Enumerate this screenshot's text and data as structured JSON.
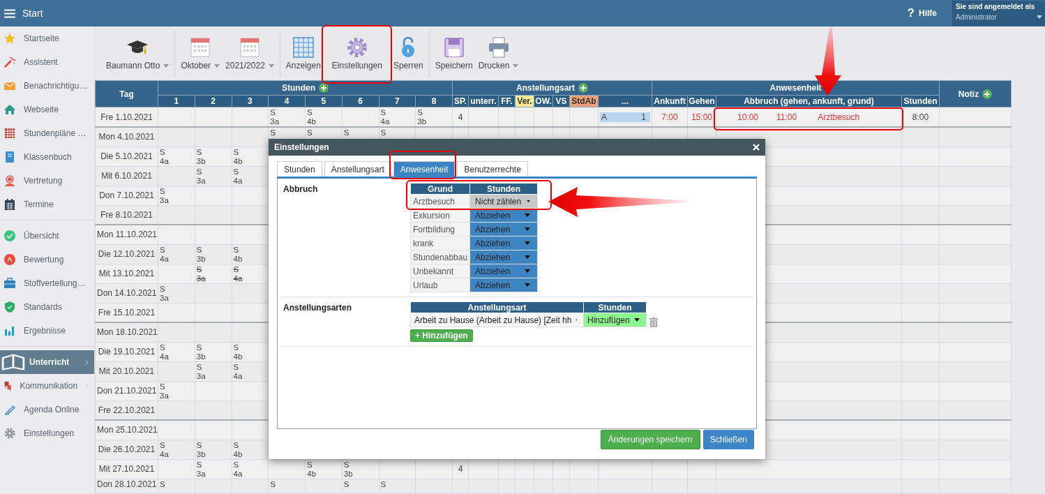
{
  "topbar": {
    "title": "Start",
    "help_symbol": "?",
    "help": "Hilfe",
    "login_label": "Sie sind angemeldet als",
    "login_user": "Administrator"
  },
  "sidebar": {
    "sections": [
      {
        "items": [
          {
            "label": "Startseite",
            "selected": false,
            "submenu": false
          },
          {
            "label": "Assistent",
            "selected": false,
            "submenu": false
          },
          {
            "label": "Benachrichtigu…",
            "selected": false,
            "submenu": false
          },
          {
            "label": "Webseite",
            "selected": false,
            "submenu": false
          },
          {
            "label": "Stundenpläne …",
            "selected": false,
            "submenu": false
          },
          {
            "label": "Klassenbuch",
            "selected": false,
            "submenu": false
          },
          {
            "label": "Vertretung",
            "selected": false,
            "submenu": false
          },
          {
            "label": "Termine",
            "selected": false,
            "submenu": false
          }
        ]
      },
      {
        "items": [
          {
            "label": "Übersicht",
            "selected": false,
            "submenu": false
          },
          {
            "label": "Bewertung",
            "selected": false,
            "submenu": false
          },
          {
            "label": "Stoffverteilung…",
            "selected": false,
            "submenu": false
          },
          {
            "label": "Standards",
            "selected": false,
            "submenu": false
          },
          {
            "label": "Ergebnisse",
            "selected": false,
            "submenu": false
          }
        ]
      },
      {
        "items": [
          {
            "label": "Unterricht",
            "selected": true,
            "submenu": true
          },
          {
            "label": "Kommunikation",
            "selected": false,
            "submenu": true
          },
          {
            "label": "Agenda Online",
            "selected": false,
            "submenu": false
          },
          {
            "label": "Einstellungen",
            "selected": false,
            "submenu": false
          }
        ]
      }
    ]
  },
  "toolbar": {
    "groups": [
      [
        {
          "label": "Baumann Otto",
          "dropdown": true
        }
      ],
      [
        {
          "label": "Oktober",
          "dropdown": true
        },
        {
          "label": "2021/2022",
          "dropdown": true
        }
      ],
      [
        {
          "label": "Anzeigen",
          "dropdown": false
        },
        {
          "label": "Einstellungen",
          "dropdown": false
        },
        {
          "label": "Sperren",
          "dropdown": false
        }
      ],
      [
        {
          "label": "Speichern",
          "dropdown": false
        },
        {
          "label": "Drucken",
          "dropdown": true
        }
      ]
    ]
  },
  "table": {
    "day_header": "Tag",
    "groups": [
      {
        "label": "Stunden",
        "addable": true,
        "columns": [
          {
            "label": "1"
          },
          {
            "label": "2"
          },
          {
            "label": "3"
          },
          {
            "label": "4"
          },
          {
            "label": "5"
          },
          {
            "label": "6"
          },
          {
            "label": "7"
          },
          {
            "label": "8"
          }
        ]
      },
      {
        "label": "Anstellungsart",
        "addable": true,
        "columns": [
          {
            "label": "SP."
          },
          {
            "label": "unterr."
          },
          {
            "label": "FF."
          },
          {
            "label": "Ver.",
            "color": "#f7e89a"
          },
          {
            "label": "OW."
          },
          {
            "label": "VS"
          },
          {
            "label": "StdAb",
            "color": "#f2a07b"
          },
          {
            "label": "..."
          }
        ]
      },
      {
        "label": "Anwesenheit",
        "addable": false,
        "columns": [
          {
            "label": "Ankunft"
          },
          {
            "label": "Gehen"
          },
          {
            "label": "Abbruch (gehen, ankunft, grund)"
          },
          {
            "label": "Stunden"
          }
        ]
      }
    ],
    "note_header": {
      "label": "Notiz",
      "addable": true
    },
    "rows": [
      {
        "day": "Fre 1.10.2021",
        "week_start": false,
        "lessons": [
          {
            "kind": "empty"
          },
          {
            "kind": "empty"
          },
          {
            "kind": "empty"
          },
          {
            "kind": "lesson",
            "subject": "S",
            "class": "3a",
            "struck": false
          },
          {
            "kind": "lesson",
            "subject": "S",
            "class": "4b",
            "struck": false
          },
          {
            "kind": "empty"
          },
          {
            "kind": "lesson",
            "subject": "S",
            "class": "4a",
            "struck": false
          },
          {
            "kind": "lesson",
            "subject": "S",
            "class": "3b",
            "struck": false
          }
        ],
        "sp": "4",
        "code": {
          "letter": "A",
          "value": "1"
        },
        "arrival": "7:00",
        "leave": "15:00",
        "abort": [
          "10:00",
          "11:00",
          "Arztbesuch"
        ],
        "hours": "8:00"
      },
      {
        "day": "Mon 4.10.2021",
        "week_start": true,
        "lessons": [
          {
            "kind": "empty"
          },
          {
            "kind": "empty"
          },
          {
            "kind": "empty"
          },
          {
            "kind": "lesson",
            "subject": "S",
            "struck": false
          },
          {
            "kind": "lesson",
            "subject": "S",
            "struck": false
          },
          {
            "kind": "lesson",
            "subject": "S",
            "struck": false
          },
          {
            "kind": "lesson",
            "subject": "S",
            "struck": false
          }
        ]
      },
      {
        "day": "Die 5.10.2021",
        "week_start": false,
        "lessons": [
          {
            "kind": "lesson",
            "subject": "S",
            "class": "4a",
            "struck": false
          },
          {
            "kind": "lesson",
            "subject": "S",
            "class": "3b",
            "struck": false
          },
          {
            "kind": "lesson",
            "subject": "S",
            "class": "4b",
            "struck": false
          }
        ]
      },
      {
        "day": "Mit 6.10.2021",
        "week_start": false,
        "lessons": [
          {
            "kind": "empty"
          },
          {
            "kind": "lesson",
            "subject": "S",
            "class": "3a",
            "struck": false
          },
          {
            "kind": "lesson",
            "subject": "S",
            "class": "4a",
            "struck": false
          }
        ]
      },
      {
        "day": "Don 7.10.2021",
        "week_start": false,
        "lessons": [
          {
            "kind": "lesson",
            "subject": "S",
            "class": "3a",
            "struck": false
          }
        ]
      },
      {
        "day": "Fre 8.10.2021",
        "week_start": false
      },
      {
        "day": "Mon 11.10.2021",
        "week_start": true
      },
      {
        "day": "Die 12.10.2021",
        "week_start": false,
        "lessons": [
          {
            "kind": "lesson",
            "subject": "S",
            "class": "4a",
            "struck": false
          },
          {
            "kind": "lesson",
            "subject": "S",
            "class": "3b",
            "struck": false
          },
          {
            "kind": "lesson",
            "subject": "S",
            "class": "4b",
            "struck": false
          }
        ]
      },
      {
        "day": "Mit 13.10.2021",
        "week_start": false,
        "lessons": [
          {
            "kind": "empty"
          },
          {
            "kind": "lesson",
            "subject": "S",
            "class": "3a",
            "struck": true
          },
          {
            "kind": "lesson",
            "subject": "S",
            "class": "4a",
            "struck": true
          }
        ]
      },
      {
        "day": "Don 14.10.2021",
        "week_start": false,
        "lessons": [
          {
            "kind": "lesson",
            "subject": "S",
            "class": "3a",
            "struck": false
          }
        ]
      },
      {
        "day": "Fre 15.10.2021",
        "week_start": false
      },
      {
        "day": "Mon 18.10.2021",
        "week_start": true
      },
      {
        "day": "Die 19.10.2021",
        "week_start": false,
        "lessons": [
          {
            "kind": "lesson",
            "subject": "S",
            "class": "4a",
            "struck": false
          },
          {
            "kind": "lesson",
            "subject": "S",
            "class": "3b",
            "struck": false
          },
          {
            "kind": "lesson",
            "subject": "S",
            "class": "4b",
            "struck": false
          }
        ]
      },
      {
        "day": "Mit 20.10.2021",
        "week_start": false,
        "lessons": [
          {
            "kind": "empty"
          },
          {
            "kind": "lesson",
            "subject": "S",
            "class": "3a",
            "struck": false
          },
          {
            "kind": "lesson",
            "subject": "S",
            "class": "4a",
            "struck": false
          }
        ]
      },
      {
        "day": "Don 21.10.2021",
        "week_start": false,
        "lessons": [
          {
            "kind": "lesson",
            "subject": "S",
            "class": "3a",
            "struck": false
          }
        ]
      },
      {
        "day": "Fre 22.10.2021",
        "week_start": false
      },
      {
        "day": "Mon 25.10.2021",
        "week_start": true
      },
      {
        "day": "Die 26.10.2021",
        "week_start": false,
        "lessons": [
          {
            "kind": "lesson",
            "subject": "S",
            "class": "4a",
            "struck": false
          },
          {
            "kind": "lesson",
            "subject": "S",
            "class": "3b",
            "struck": false
          },
          {
            "kind": "lesson",
            "subject": "S",
            "class": "4b",
            "struck": false
          }
        ]
      },
      {
        "day": "Mit 27.10.2021",
        "week_start": false,
        "lessons": [
          {
            "kind": "empty"
          },
          {
            "kind": "lesson",
            "subject": "S",
            "class": "3a",
            "struck": false
          },
          {
            "kind": "lesson",
            "subject": "S",
            "class": "4a",
            "struck": false
          },
          {
            "kind": "empty"
          },
          {
            "kind": "lesson",
            "subject": "S",
            "class": "4b",
            "struck": false
          },
          {
            "kind": "lesson",
            "subject": "S",
            "class": "3b",
            "struck": false
          }
        ],
        "sp": "4"
      },
      {
        "day": "Don 28.10.2021",
        "week_start": false,
        "lessons": [
          {
            "kind": "lesson",
            "subject": "S",
            "struck": false
          },
          {
            "kind": "empty"
          },
          {
            "kind": "empty"
          },
          {
            "kind": "lesson",
            "subject": "S",
            "struck": false
          },
          {
            "kind": "empty"
          },
          {
            "kind": "lesson",
            "subject": "S",
            "struck": false
          },
          {
            "kind": "lesson",
            "subject": "S",
            "struck": false
          }
        ]
      }
    ]
  },
  "dialog": {
    "title": "Einstellungen",
    "tabs": [
      {
        "label": "Stunden",
        "selected": false
      },
      {
        "label": "Anstellungsart",
        "selected": false
      },
      {
        "label": "Anwesenheit",
        "selected": true
      },
      {
        "label": "Benutzerrechte",
        "selected": false
      }
    ],
    "abort_section": {
      "label": "Abbruch",
      "columns": [
        "Grund",
        "Stunden"
      ],
      "rows": [
        {
          "reason": "Arztbesuch",
          "hours": "Nicht zählen",
          "focused": true
        },
        {
          "reason": "Exkursion",
          "hours": "Abziehen",
          "focused": false
        },
        {
          "reason": "Fortbildung",
          "hours": "Abziehen",
          "focused": false
        },
        {
          "reason": "krank",
          "hours": "Abziehen",
          "focused": false
        },
        {
          "reason": "Stundenabbau",
          "hours": "Abziehen",
          "focused": false
        },
        {
          "reason": "Unbekannt",
          "hours": "Abziehen",
          "focused": false
        },
        {
          "reason": "Urlaub",
          "hours": "Abziehen",
          "focused": false
        }
      ]
    },
    "types_section": {
      "label": "Anstellungsarten",
      "columns": [
        "Anstellungsart",
        "Stunden"
      ],
      "rows": [
        {
          "type": "Arbeit zu Hause (Arbeit zu Hause) [Zeit hh",
          "hours": "Hinzufügen"
        }
      ],
      "add_button": "+ Hinzufügen"
    },
    "buttons": [
      {
        "label": "Änderungen speichern",
        "kind": "success"
      },
      {
        "label": "Schließen",
        "kind": "primary"
      }
    ]
  }
}
